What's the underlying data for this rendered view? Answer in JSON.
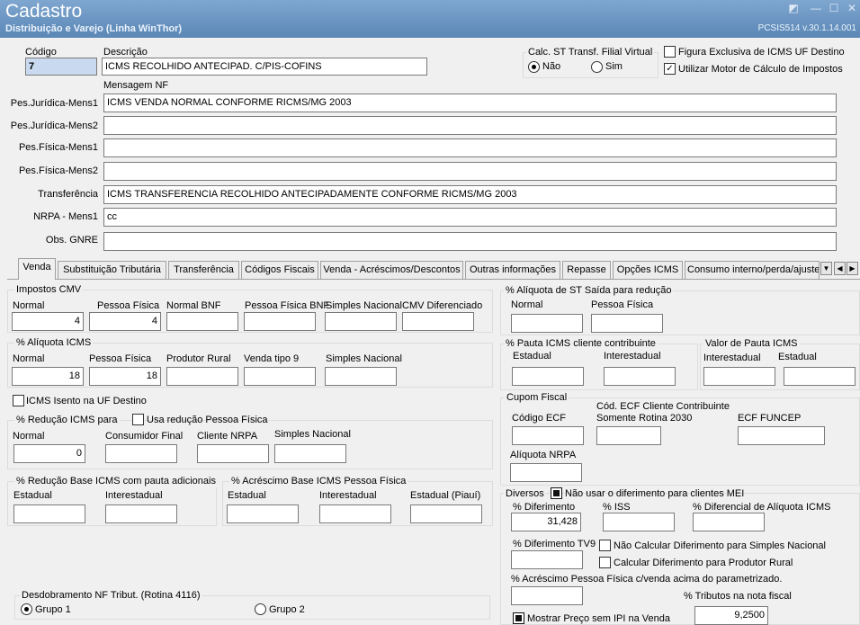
{
  "window": {
    "title": "Cadastro",
    "subtitle": "Distribuição e Varejo (Linha WinThor)",
    "version": "PCSIS514  v.30.1.14.001",
    "icons": {
      "pin": "pin-icon",
      "minimize": "minimize-icon",
      "maximize": "maximize-icon",
      "close": "close-icon"
    },
    "glyphs": {
      "pin": "◩",
      "minimize": "—",
      "maximize": "☐",
      "close": "✕"
    }
  },
  "header": {
    "codigo_label": "Código",
    "codigo_value": "7",
    "descricao_label": "Descrição",
    "descricao_value": "ICMS RECOLHIDO ANTECIPAD. C/PIS-COFINS",
    "calc_st": {
      "title": "Calc. ST Transf. Filial Virtual",
      "options": [
        "Não",
        "Sim"
      ],
      "selected": "Não"
    },
    "figura_exclusiva_label": "Figura Exclusiva de ICMS UF Destino",
    "figura_exclusiva_checked": false,
    "utilizar_motor_label": "Utilizar Motor de Cálculo de Impostos",
    "utilizar_motor_checked": true,
    "check_mark": "✓"
  },
  "mensagem": {
    "section_label": "Mensagem NF",
    "fields": [
      {
        "label": "Pes.Jurídica-Mens1",
        "value": "ICMS  VENDA NORMAL  CONFORME RICMS/MG 2003"
      },
      {
        "label": "Pes.Jurídica-Mens2",
        "value": ""
      },
      {
        "label": "Pes.Física-Mens1",
        "value": ""
      },
      {
        "label": "Pes.Física-Mens2",
        "value": ""
      },
      {
        "label": "Transferência",
        "value": "ICMS  TRANSFERENCIA  RECOLHIDO ANTECIPADAMENTE CONFORME RICMS/MG 2003"
      },
      {
        "label": "NRPA - Mens1",
        "value": "cc"
      },
      {
        "label": "Obs. GNRE",
        "value": ""
      }
    ]
  },
  "tabs": {
    "items": [
      "Venda",
      "Substituição Tributária",
      "Transferência",
      "Códigos Fiscais",
      "Venda - Acréscimos/Descontos",
      "Outras informações",
      "Repasse",
      "Opções ICMS",
      "Consumo interno/perda/ajuste"
    ],
    "active": "Venda",
    "scroll": {
      "dropdown": "▼",
      "left": "◀",
      "right": "▶"
    }
  },
  "venda": {
    "impostos_cmv": {
      "title": "Impostos CMV",
      "fields": [
        {
          "label": "Normal",
          "value": "4"
        },
        {
          "label": "Pessoa Física",
          "value": "4"
        },
        {
          "label": "Normal BNF",
          "value": ""
        },
        {
          "label": "Pessoa Física BNF",
          "value": ""
        },
        {
          "label": "Simples Nacional",
          "value": ""
        },
        {
          "label": "CMV Diferenciado",
          "value": ""
        }
      ]
    },
    "aliquota_icms": {
      "title": "% Alíquota ICMS",
      "fields": [
        {
          "label": "Normal",
          "value": "18"
        },
        {
          "label": "Pessoa Física",
          "value": "18"
        },
        {
          "label": "Produtor Rural",
          "value": ""
        },
        {
          "label": "Venda tipo 9",
          "value": ""
        },
        {
          "label": "Simples Nacional",
          "value": ""
        }
      ]
    },
    "icms_isento_label": "ICMS Isento na UF Destino",
    "reducao_icms": {
      "title": "% Redução ICMS para",
      "usa_reducao_label": "Usa redução Pessoa Física",
      "fields": [
        {
          "label": "Normal",
          "value": "0"
        },
        {
          "label": "Consumidor Final",
          "value": ""
        },
        {
          "label": "Cliente NRPA",
          "value": ""
        },
        {
          "label": "Simples Nacional",
          "value": ""
        }
      ]
    },
    "reducao_base": {
      "title": "% Redução Base ICMS com pauta adicionais",
      "fields": [
        {
          "label": "Estadual",
          "value": ""
        },
        {
          "label": "Interestadual",
          "value": ""
        }
      ]
    },
    "acrescimo_base": {
      "title": "% Acréscimo Base ICMS Pessoa Física",
      "fields": [
        {
          "label": "Estadual",
          "value": ""
        },
        {
          "label": "Interestadual",
          "value": ""
        },
        {
          "label": "Estadual (Piauí)",
          "value": ""
        }
      ]
    },
    "desdobramento": {
      "title": "Desdobramento NF Tribut. (Rotina 4116)",
      "options": [
        "Grupo 1",
        "Grupo 2"
      ],
      "selected": "Grupo 1"
    },
    "aliquota_st": {
      "title": "% Alíquota de ST Saída para redução",
      "fields": [
        {
          "label": "Normal",
          "value": ""
        },
        {
          "label": "Pessoa Física",
          "value": ""
        }
      ]
    },
    "pauta_icms": {
      "title": "% Pauta ICMS cliente contribuinte",
      "fields": [
        {
          "label": "Estadual",
          "value": ""
        },
        {
          "label": "Interestadual",
          "value": ""
        }
      ]
    },
    "valor_pauta": {
      "title": "Valor de Pauta ICMS",
      "fields": [
        {
          "label": "Interestadual",
          "value": ""
        },
        {
          "label": "Estadual",
          "value": ""
        }
      ]
    },
    "cupom_fiscal": {
      "title": "Cupom Fiscal",
      "codigo_ecf_label": "Código ECF",
      "cod_ecf_cliente_label_1": "Cód. ECF Cliente Contribuinte",
      "cod_ecf_cliente_label_2": "Somente Rotina 2030",
      "ecf_funcep_label": "ECF FUNCEP",
      "aliquota_nrpa_label": "Alíquota NRPA"
    },
    "diversos": {
      "title": "Diversos",
      "nao_usar_diferimento_label": "Não usar o diferimento para clientes MEI",
      "diferimento_label": "% Diferimento",
      "diferimento_value": "31,428",
      "iss_label": "% ISS",
      "iss_value": "",
      "diferencial_label": "% Diferencial de Alíquota ICMS",
      "diferencial_value": "",
      "diferimento_tv9_label": "% Diferimento TV9",
      "diferimento_tv9_value": "",
      "nao_calcular_label": "Não Calcular Diferimento para Simples Nacional",
      "calcular_produtor_label": "Calcular Diferimento para Produtor Rural",
      "acrescimo_pf_label": "% Acréscimo Pessoa Física c/venda acima do parametrizado.",
      "acrescimo_pf_value": "",
      "tributos_label": "% Tributos na nota fiscal",
      "tributos_value": "9,2500",
      "mostrar_preco_label": "Mostrar Preço sem IPI na Venda"
    }
  }
}
